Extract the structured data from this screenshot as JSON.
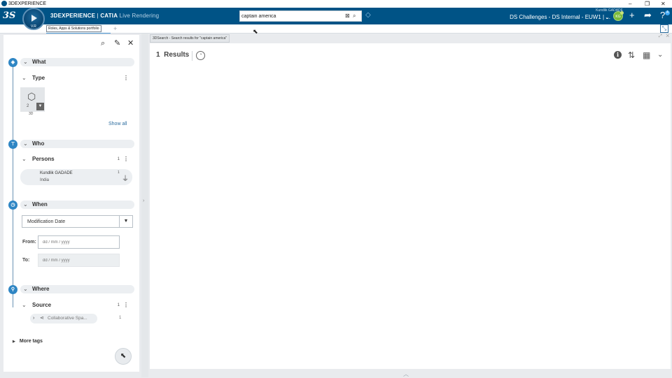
{
  "os": {
    "title": "3DEXPERIENCE",
    "minimize": "–",
    "restore": "❐",
    "close": "✕"
  },
  "topbar": {
    "logo": "3S",
    "compass_version": "V.R",
    "brand_1": "3DEXPERIENCE",
    "brand_sep": " | ",
    "brand_2": "CATIA",
    "brand_3": " Live Rendering",
    "search_value": "captain america",
    "search_clear_icon": "⊠",
    "search_icon": "⌕",
    "tag_icon": "◇",
    "user_name": "Kundlik GADADE",
    "tenant": "DS Challenges - DS Internal - EUW1 | ...",
    "tenant_caret": "⌄",
    "avatar_initials": "KG",
    "add_icon": "+",
    "share_icon": "➦",
    "help_icon": "?",
    "help_badge": "A",
    "accent_color": "#005386"
  },
  "secbar": {
    "roles_tab": "Roles, Apps & Solutions portfolio",
    "add_tab": "+",
    "fullscreen_icon": "⤡"
  },
  "left_panel": {
    "icons": {
      "search": "⌕",
      "tag": "✎",
      "close": "✕"
    },
    "what": {
      "label": "What",
      "type": {
        "label": "Type",
        "menu": "⋮",
        "tile_count": "2",
        "tile_label": "3D",
        "show_all": "Show all"
      }
    },
    "who": {
      "label": "Who",
      "persons": {
        "label": "Persons",
        "count": "1",
        "menu": "⋮",
        "name": "Kundlik GADADE",
        "country": "India",
        "item_count": "1"
      }
    },
    "when": {
      "label": "When",
      "date_type": "Modification Date",
      "from_label": "From:",
      "to_label": "To:",
      "from_placeholder": "dd / mm / yyyy",
      "to_placeholder": "dd / mm / yyyy"
    },
    "where": {
      "label": "Where",
      "source": {
        "label": "Source",
        "count": "1",
        "menu": "⋮",
        "item": "Collaborative Spa...",
        "item_count": "1"
      }
    },
    "more_tags": "More tags"
  },
  "main": {
    "tab_title": "3DSearch - Search results for \"captain america\"",
    "result_count": "1",
    "results_label": "Results",
    "window_controls": "⤢ ✕"
  }
}
